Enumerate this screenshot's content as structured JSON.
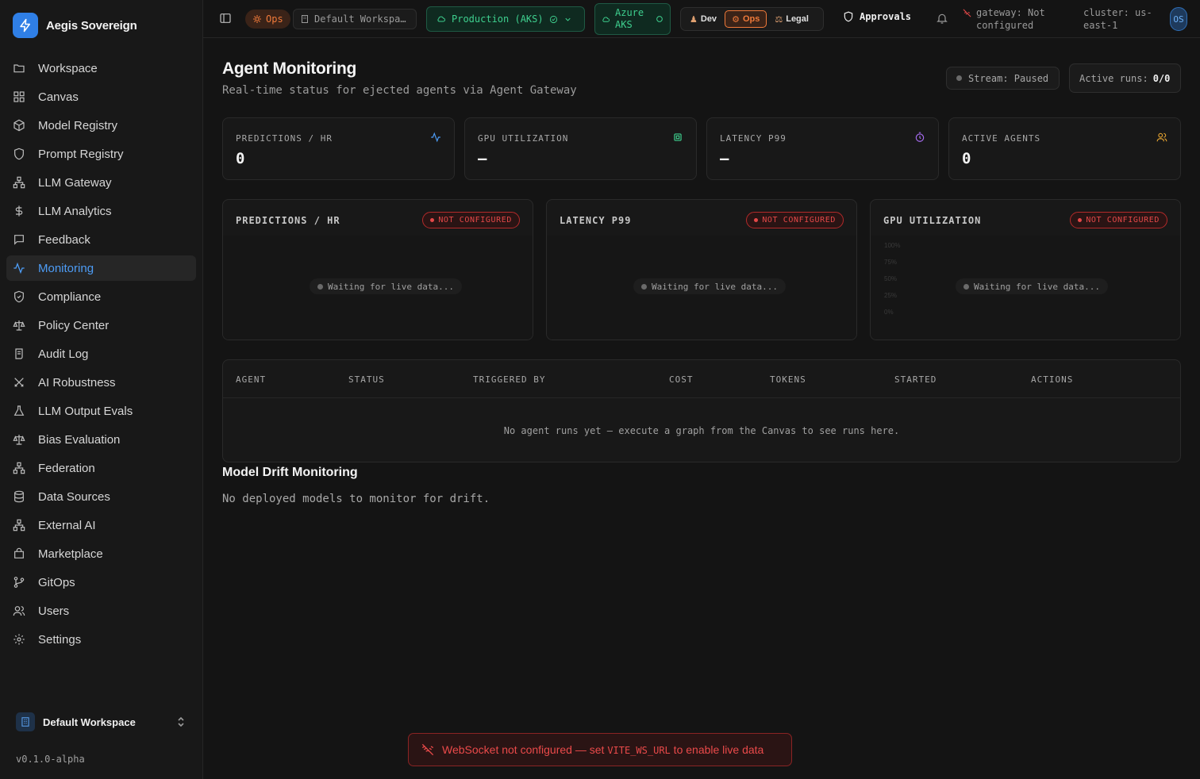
{
  "brand": {
    "name": "Aegis Sovereign"
  },
  "sidebar": {
    "items": [
      {
        "label": "Workspace",
        "icon": "folder-icon"
      },
      {
        "label": "Canvas",
        "icon": "layout-grid-icon"
      },
      {
        "label": "Model Registry",
        "icon": "box-icon"
      },
      {
        "label": "Prompt Registry",
        "icon": "shield-icon"
      },
      {
        "label": "LLM Gateway",
        "icon": "network-icon"
      },
      {
        "label": "LLM Analytics",
        "icon": "dollar-icon"
      },
      {
        "label": "Feedback",
        "icon": "message-icon"
      },
      {
        "label": "Monitoring",
        "icon": "activity-icon",
        "active": true
      },
      {
        "label": "Compliance",
        "icon": "shield-check-icon"
      },
      {
        "label": "Policy Center",
        "icon": "scale-icon"
      },
      {
        "label": "Audit Log",
        "icon": "scroll-icon"
      },
      {
        "label": "AI Robustness",
        "icon": "swords-icon"
      },
      {
        "label": "LLM Output Evals",
        "icon": "flask-icon"
      },
      {
        "label": "Bias Evaluation",
        "icon": "scale-icon"
      },
      {
        "label": "Federation",
        "icon": "network-icon"
      },
      {
        "label": "Data Sources",
        "icon": "database-icon"
      },
      {
        "label": "External AI",
        "icon": "network-icon"
      },
      {
        "label": "Marketplace",
        "icon": "store-icon"
      },
      {
        "label": "GitOps",
        "icon": "git-branch-icon"
      },
      {
        "label": "Users",
        "icon": "users-icon"
      },
      {
        "label": "Settings",
        "icon": "gear-icon"
      }
    ],
    "workspace": "Default Workspace",
    "version": "v0.1.0-alpha"
  },
  "topbar": {
    "ops_badge": "Ops",
    "workspace": "Default Workspa…",
    "environment": "Production (AKS)",
    "cloud_line1": "Azure",
    "cloud_line2": "AKS",
    "personas": [
      "Dev",
      "Ops",
      "Legal"
    ],
    "active_persona": "Ops",
    "approvals": "Approvals",
    "gateway_line1": "gateway: Not",
    "gateway_line2": "configured",
    "cluster_line1": "cluster: us-",
    "cluster_line2": "east-1",
    "avatar": "OS"
  },
  "page": {
    "title": "Agent Monitoring",
    "subtitle": "Real-time status for ejected agents via Agent Gateway",
    "stream": "Stream: Paused",
    "active_runs_label": "Active runs:",
    "active_runs_value": "0/0"
  },
  "stats": [
    {
      "label": "PREDICTIONS / HR",
      "value": "0",
      "icon": "activity-icon",
      "color": "#4d9cf5"
    },
    {
      "label": "GPU UTILIZATION",
      "value": "—",
      "icon": "cpu-icon",
      "color": "#3ecf8e"
    },
    {
      "label": "LATENCY P99",
      "value": "—",
      "icon": "timer-icon",
      "color": "#a66cf0"
    },
    {
      "label": "ACTIVE AGENTS",
      "value": "0",
      "icon": "users-icon",
      "color": "#e0a030"
    }
  ],
  "charts": [
    {
      "title": "PREDICTIONS / HR",
      "status": "NOT CONFIGURED",
      "waiting": "Waiting for live data..."
    },
    {
      "title": "LATENCY P99",
      "status": "NOT CONFIGURED",
      "waiting": "Waiting for live data..."
    },
    {
      "title": "GPU UTILIZATION",
      "status": "NOT CONFIGURED",
      "waiting": "Waiting for live data...",
      "y_ticks": [
        "100%",
        "75%",
        "50%",
        "25%",
        "0%"
      ]
    }
  ],
  "runs_table": {
    "columns": [
      "AGENT",
      "STATUS",
      "TRIGGERED BY",
      "COST",
      "TOKENS",
      "STARTED",
      "ACTIONS"
    ],
    "empty": "No agent runs yet — execute a graph from the Canvas to see runs here."
  },
  "drift": {
    "title": "Model Drift Monitoring",
    "empty": "No deployed models to monitor for drift."
  },
  "toast": {
    "prefix": "WebSocket not configured — set ",
    "code": "VITE_WS_URL",
    "suffix": " to enable live data"
  }
}
